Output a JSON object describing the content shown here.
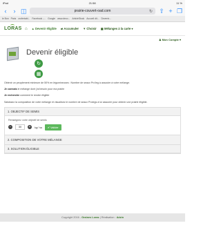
{
  "status": {
    "carrier": "iPad",
    "time": "21:58",
    "battery": "11 %"
  },
  "browser": {
    "url": "prairie-couvert-oad.com",
    "reload_icon": "reload-icon"
  },
  "favorites": [
    "le Bon",
    "Pariz",
    "crofertabl...",
    "Facebook -...",
    "Google",
    "www.deco...",
    "ArticleStock",
    "Accueil dit...",
    "Devenir..."
  ],
  "header": {
    "logo": "LORAS",
    "menu": [
      "Devenir éligible",
      "Accumuler",
      "Choisir",
      "Mélanges à la carte"
    ],
    "account": "Mon Compte"
  },
  "hero": {
    "title": "Devenir éligible"
  },
  "intro": {
    "line1": "Obtenir un peuplement minimum de 50% en légumineuses : Nombre de seaux Pro'leg à associer à votre mélange.",
    "connais_bold": "Je connais",
    "connais_rest": " le mélange dont j'ai besoin pour ma prairie",
    "recherche_bold": "Je recherche",
    "recherche_rest": " comment le rendre éligible",
    "line4": "Saisissez la composition de votre mélange et visualisez le nombre de seaux Prolegs à lui associer pour obtenir une prairie éligible."
  },
  "accordion": {
    "section1": "1. OBJECTIF DE SEMIS",
    "hint": "Renseignez votre objectif de semis",
    "quantity": "30",
    "unit": "kg/ ha",
    "validate": "Valider",
    "section2": "2. COMPOSITION DE VOTRE MÉLANGE",
    "section3": "3. SOLUTION ÉLIGIBLE"
  },
  "footer": {
    "prefix": "Copyright 2016 - ",
    "brand": "Graines Loras",
    "mid": " | Réalisation : ",
    "agency": "Adzin"
  }
}
